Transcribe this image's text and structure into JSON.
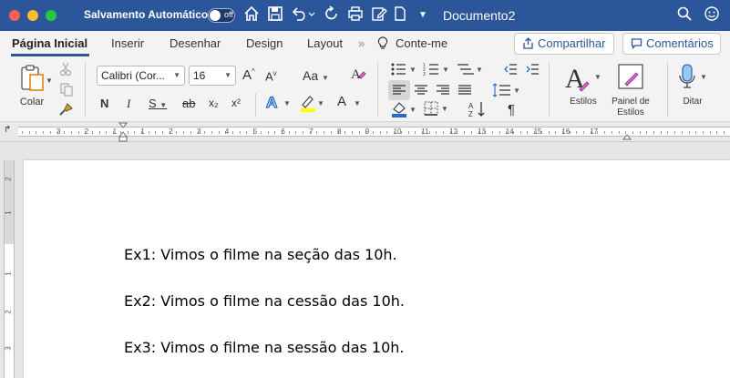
{
  "titlebar": {
    "autosave_label": "Salvamento Automático",
    "autosave_state": "off",
    "document_title": "Documento2"
  },
  "tabs": {
    "items": [
      "Página Inicial",
      "Inserir",
      "Desenhar",
      "Design",
      "Layout"
    ],
    "tell_me": "Conte-me",
    "share_label": "Compartilhar",
    "comments_label": "Comentários"
  },
  "ribbon": {
    "paste_label": "Colar",
    "font_name": "Calibri (Cor...",
    "font_size": "16",
    "bold": "N",
    "italic": "I",
    "underline": "S",
    "strike": "ab",
    "subscript": "x₂",
    "superscript": "x²",
    "grow_font": "A",
    "shrink_font": "A",
    "change_case": "Aa",
    "font_color": "A",
    "styles_label": "Estilos",
    "styles_pane_label_1": "Painel de",
    "styles_pane_label_2": "Estilos",
    "dictate_label": "Ditar",
    "pilcrow": "¶"
  },
  "ruler": {
    "numbers": [
      "3",
      "2",
      "1",
      "1",
      "2",
      "3",
      "4",
      "5",
      "6",
      "7",
      "8",
      "9",
      "10",
      "11",
      "12",
      "13",
      "14",
      "15",
      "16",
      "17"
    ]
  },
  "vruler": {
    "numbers": [
      "2",
      "1",
      "1",
      "2",
      "3"
    ]
  },
  "document": {
    "lines": [
      "Ex1: Vimos o filme na seção das 10h.",
      "Ex2: Vimos o filme na cessão das 10h.",
      "Ex3: Vimos o filme na sessão das 10h."
    ]
  },
  "colors": {
    "titlebar": "#2b579a",
    "highlight": "#ffff00",
    "font_color": "#ff0000"
  }
}
